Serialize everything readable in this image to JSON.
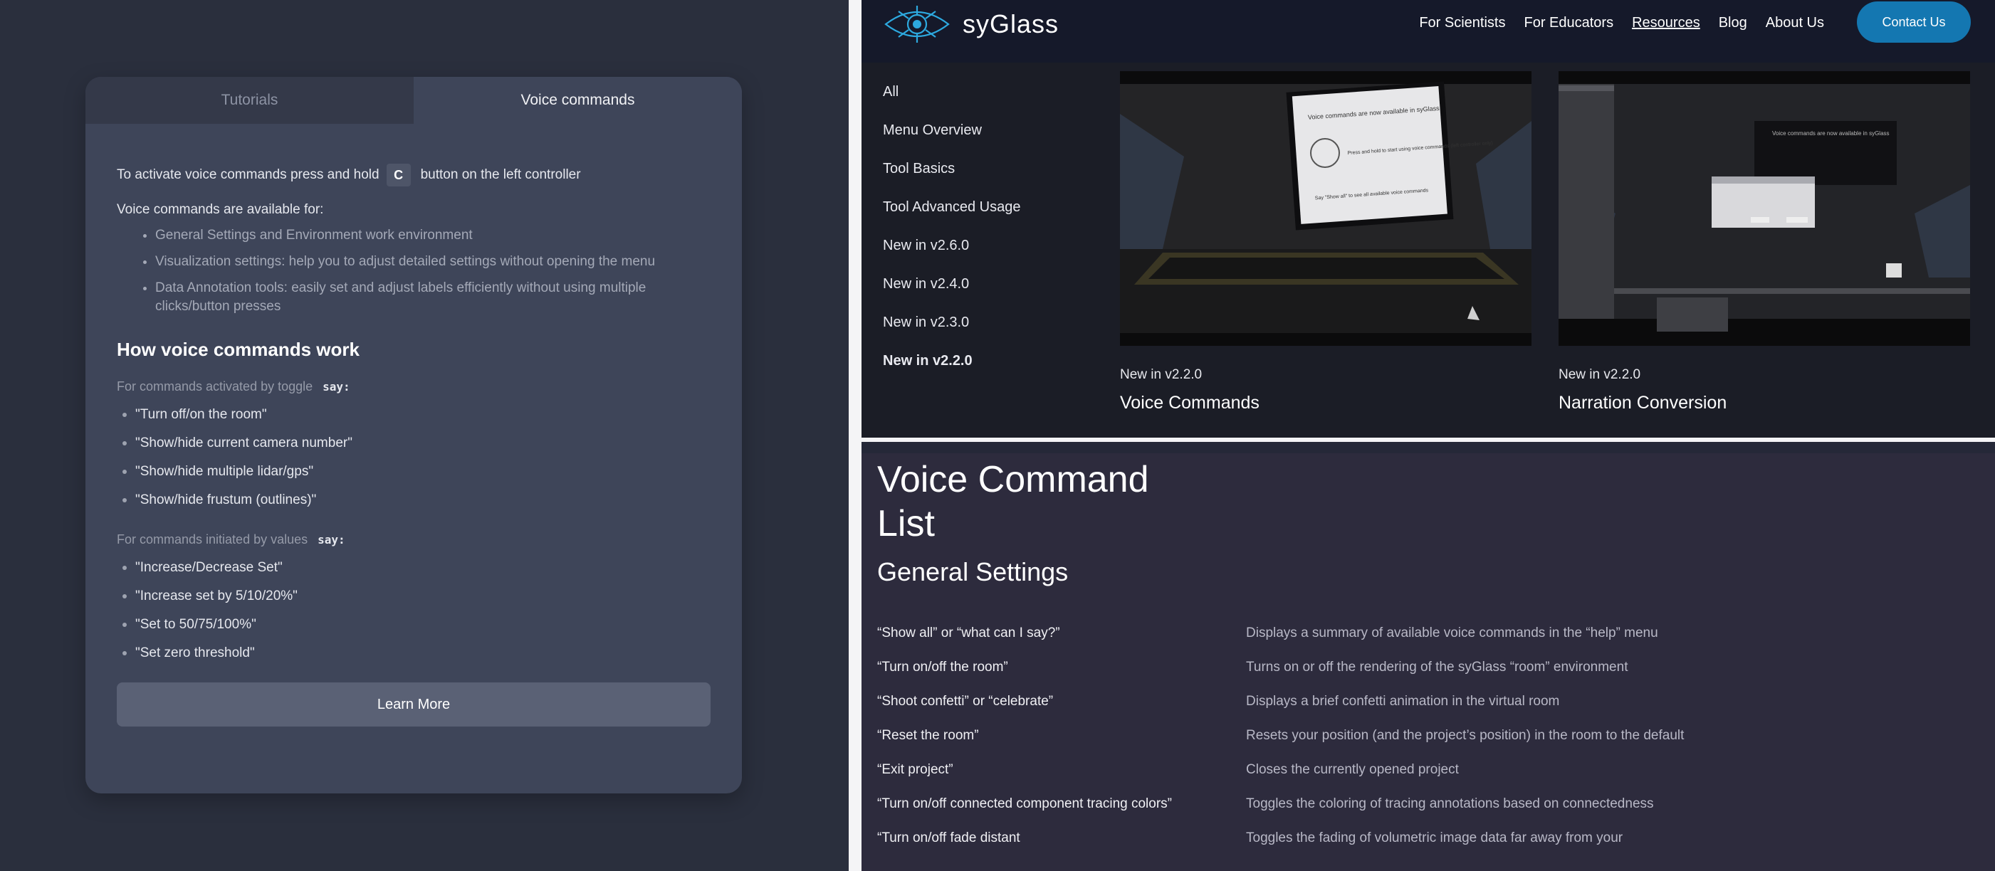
{
  "left_panel": {
    "tabs": [
      {
        "label": "Tutorials",
        "active": false
      },
      {
        "label": "Voice commands",
        "active": true
      }
    ],
    "activate_prefix": "To activate voice commands press and hold",
    "activate_key": "C",
    "activate_suffix": "button on the left controller",
    "available_label": "Voice commands are available for:",
    "available_items": [
      "General Settings and Environment work environment",
      "Visualization settings: help you to adjust detailed settings without opening the menu",
      "Data Annotation tools: easily set and adjust labels efficiently without using multiple clicks/button presses"
    ],
    "how_title": "How voice commands work",
    "toggle_label": "For commands activated by toggle",
    "toggle_say": "say:",
    "toggle_commands": [
      "\"Turn off/on the room\"",
      "\"Show/hide current camera number\"",
      "\"Show/hide multiple lidar/gps\"",
      "\"Show/hide frustum (outlines)\""
    ],
    "values_label": "For commands initiated by values",
    "values_say": "say:",
    "values_commands": [
      "\"Increase/Decrease Set\"",
      "\"Increase set by 5/10/20%\"",
      "\"Set to 50/75/100%\"",
      "\"Set zero threshold\""
    ],
    "learn_more": "Learn More"
  },
  "site": {
    "logo_text": "syGlass",
    "nav": [
      {
        "label": "For Scientists",
        "underlined": false
      },
      {
        "label": "For Educators",
        "underlined": false
      },
      {
        "label": "Resources",
        "underlined": true
      },
      {
        "label": "Blog",
        "underlined": false
      },
      {
        "label": "About Us",
        "underlined": false
      }
    ],
    "contact": "Contact Us",
    "side_menu": [
      {
        "label": "All",
        "active": false
      },
      {
        "label": "Menu Overview",
        "active": false
      },
      {
        "label": "Tool Basics",
        "active": false
      },
      {
        "label": "Tool Advanced Usage",
        "active": false
      },
      {
        "label": "New in v2.6.0",
        "active": false
      },
      {
        "label": "New in v2.4.0",
        "active": false
      },
      {
        "label": "New in v2.3.0",
        "active": false
      },
      {
        "label": "New in v2.2.0",
        "active": true
      }
    ],
    "videos": [
      {
        "version": "New in v2.2.0",
        "title": "Voice Commands",
        "thumb_caption": "Voice commands are now available in syGlass",
        "thumb_hint": "Press and hold to start using voice commands (left controller only)",
        "thumb_say": "Say \"Show all\" to see all available voice commands"
      },
      {
        "version": "New in v2.2.0",
        "title": "Narration Conversion",
        "thumb_caption": "Voice commands are now available in syGlass"
      }
    ]
  },
  "command_list": {
    "title": "Voice Command List",
    "section": "General Settings",
    "rows": [
      {
        "cmd": "“Show all” or “what can I say?”",
        "desc": "Displays a summary of available voice commands in the “help” menu"
      },
      {
        "cmd": "“Turn on/off the room”",
        "desc": "Turns on or off the rendering of the syGlass “room” environment"
      },
      {
        "cmd": "“Shoot confetti” or “celebrate”",
        "desc": "Displays a brief confetti animation in the virtual room"
      },
      {
        "cmd": "“Reset the room”",
        "desc": "Resets your position (and the project’s position) in the room to the default"
      },
      {
        "cmd": "“Exit project”",
        "desc": "Closes the currently opened project"
      },
      {
        "cmd": "“Turn on/off connected component tracing colors”",
        "desc": "Toggles the coloring of tracing annotations based on connectedness"
      },
      {
        "cmd": "“Turn on/off fade distant",
        "desc": "Toggles the fading of volumetric image data far away from your"
      }
    ]
  }
}
